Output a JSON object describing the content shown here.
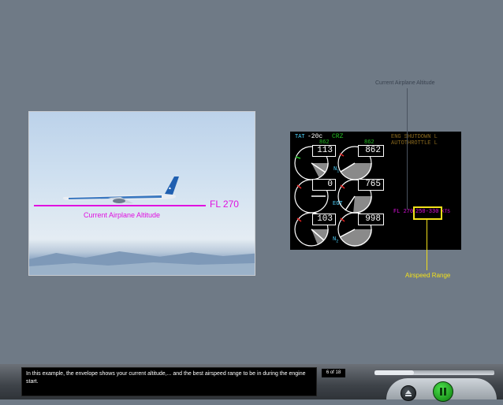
{
  "photo": {
    "fl_label": "FL 270",
    "altitude_label": "Current Airplane Altitude"
  },
  "eicas": {
    "tat_label": "TAT",
    "tat_value": "-20c",
    "mode": "CRZ",
    "message_line1": "ENG SHUTDOWN L",
    "message_line2": "AUTOTHROTTLE L",
    "n1_left_small": "862",
    "n1_right_small": "862",
    "n1_left": "113",
    "n1_right": "862",
    "n1_label": "N",
    "n1_sub": "1",
    "egt_left": "0",
    "egt_right": "765",
    "egt_label": "EGT",
    "n2_left": "103",
    "n2_right": "998",
    "n2_label": "N",
    "n2_sub": "2",
    "fl_text": "FL 270",
    "speed_range": "250-330",
    "speed_unit": "KTS"
  },
  "callouts": {
    "top": "Current Airplane Altitude",
    "bottom": "Airspeed Range"
  },
  "player": {
    "caption": "In this example, the envelope shows your current altitude,... and the best airspeed range to be in during the engine start.",
    "page_counter": "6 of 18",
    "progress": 0.33,
    "colors": {
      "accent_green": "#22c022",
      "magenta": "#e010e0",
      "yellow": "#f2e01a"
    }
  }
}
